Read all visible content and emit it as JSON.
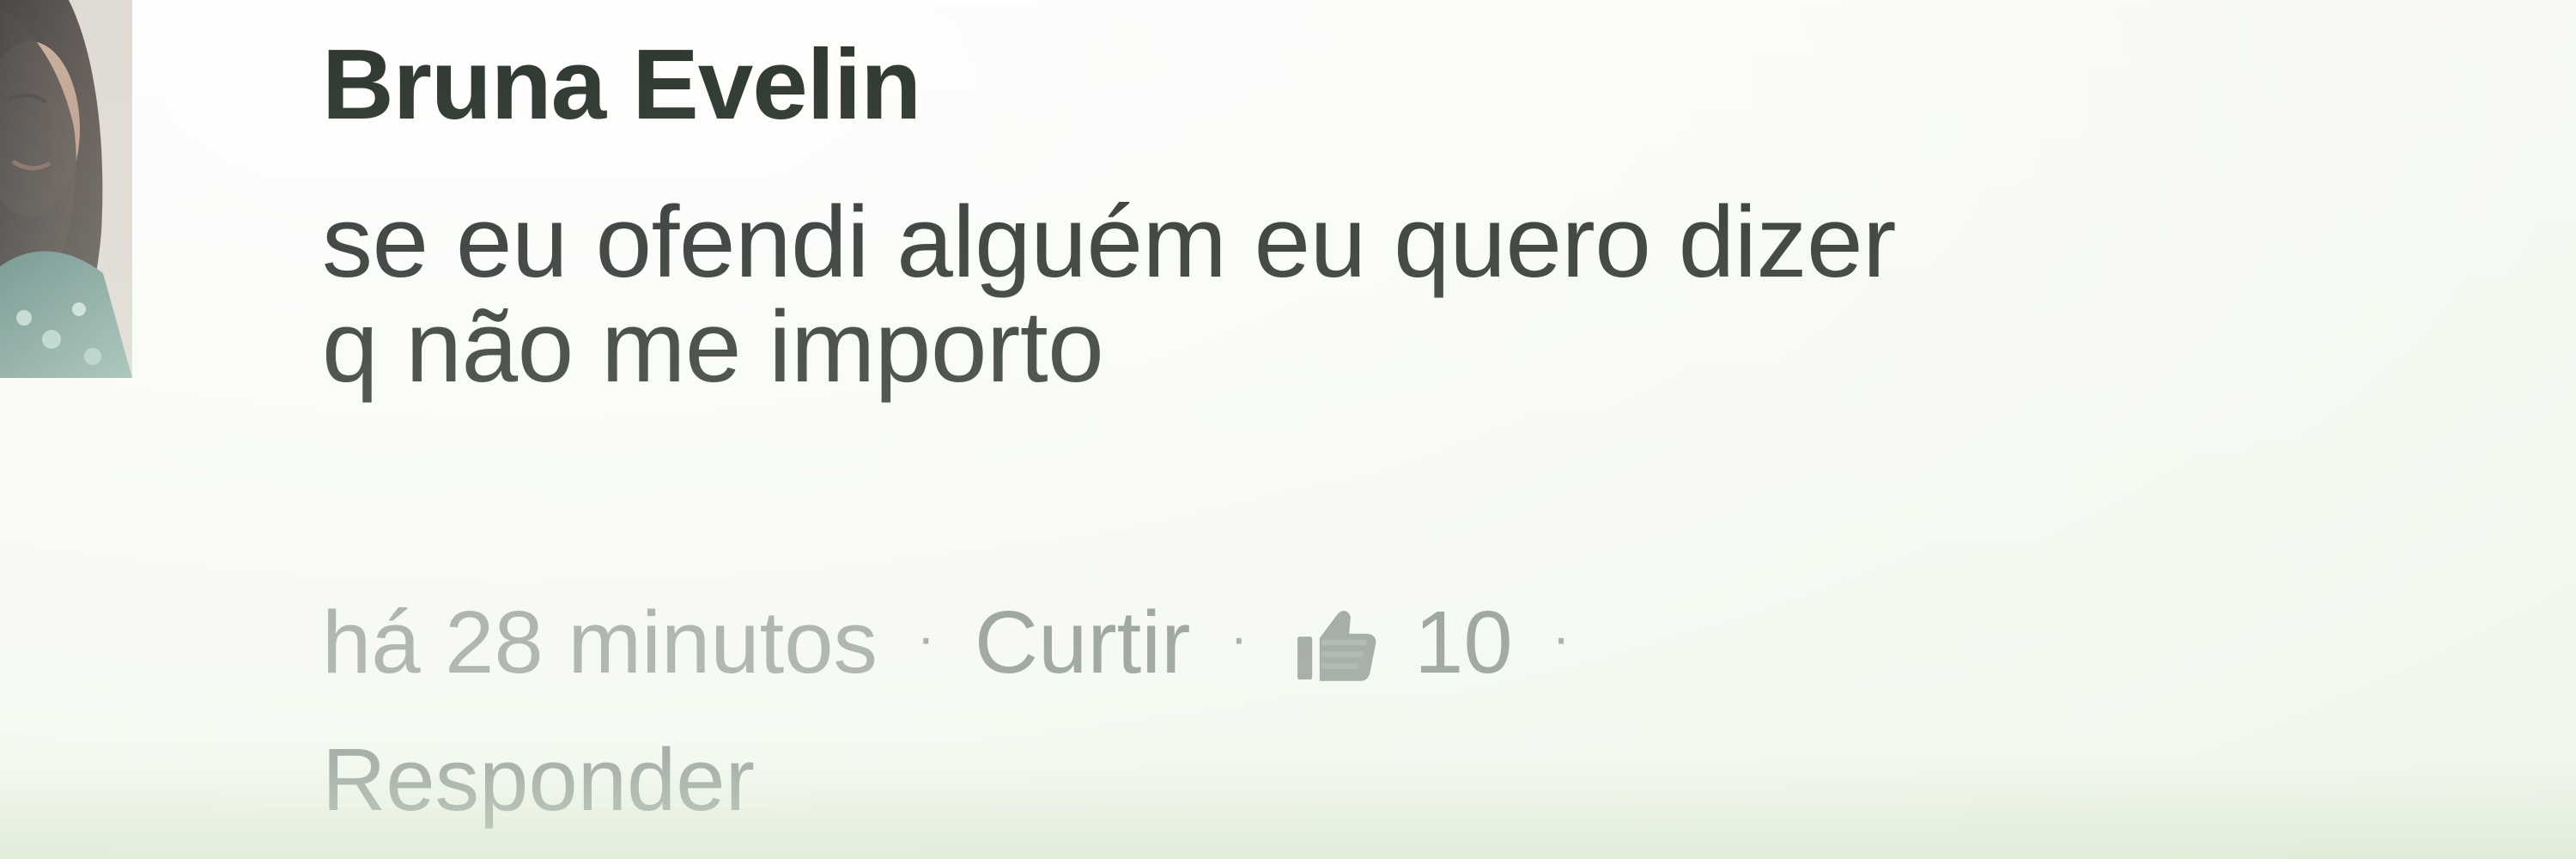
{
  "comment": {
    "author": "Bruna Evelin",
    "text_lines": [
      "se eu ofendi alguém eu quero dizer",
      "q não me importo"
    ],
    "timestamp": "há 28 minutos",
    "separator": "·",
    "actions": {
      "like_label": "Curtir",
      "like_count": "10",
      "reply_label": "Responder"
    }
  },
  "icons": {
    "like_count_icon": "thumbs-up-icon"
  },
  "colors": {
    "background": "#f7faf4",
    "author_text": "#2b342d",
    "comment_text": "#2f3431",
    "meta_text": "#848c89"
  }
}
